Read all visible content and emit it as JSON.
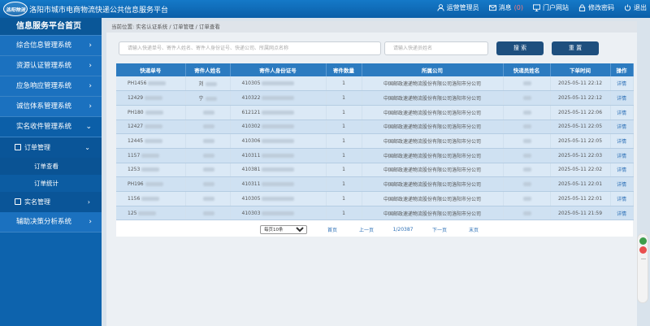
{
  "header": {
    "logo_text": "洛阳物流",
    "site_title": "洛阳市城市电商物流快递公共信息服务平台",
    "nav": [
      {
        "label": "运营管理员",
        "icon": "user-icon"
      },
      {
        "label": "消息",
        "count": "(0)",
        "icon": "mail-icon"
      },
      {
        "label": "门户网站",
        "icon": "monitor-icon"
      },
      {
        "label": "修改密码",
        "icon": "lock-icon"
      },
      {
        "label": "退出",
        "icon": "power-icon"
      }
    ]
  },
  "sidebar": {
    "title": "信息服务平台首页",
    "items": [
      {
        "label": "综合信息管理系统"
      },
      {
        "label": "资源认证管理系统"
      },
      {
        "label": "应急响应管理系统"
      },
      {
        "label": "诚信体系管理系统"
      },
      {
        "label": "实名收件管理系统"
      },
      {
        "label": "订单管理"
      },
      {
        "label": "订单查看"
      },
      {
        "label": "订单统计"
      },
      {
        "label": "实名管理"
      },
      {
        "label": "辅助决策分析系统"
      }
    ]
  },
  "breadcrumb": "当前位置: 实名认证系统 / 订单管理 / 订单查看",
  "search": {
    "placeholder_main": "请输入快递单号、寄件人姓名、寄件人身份证号、快递公司、所属网点名称",
    "placeholder_staff": "请输入快递员姓名",
    "search_label": "搜 索",
    "reset_label": "重 置"
  },
  "table": {
    "columns": [
      "快递单号",
      "寄件人姓名",
      "寄件人身份证号",
      "寄件数量",
      "所属公司",
      "快递员姓名",
      "下单时间",
      "操作"
    ],
    "rows": [
      {
        "no": "PH1456",
        "name": "刘",
        "id": "410305",
        "qty": "1",
        "company": "中国邮政速递物流股份有限公司洛阳市分公司",
        "courier": "",
        "time": "2025-05-11 22:12",
        "op": "详情"
      },
      {
        "no": "12429",
        "name": "宁",
        "id": "410322",
        "qty": "1",
        "company": "中国邮政速递物流股份有限公司洛阳市分公司",
        "courier": "",
        "time": "2025-05-11 22:12",
        "op": "详情"
      },
      {
        "no": "PH180",
        "name": "",
        "id": "612121",
        "qty": "1",
        "company": "中国邮政速递物流股份有限公司洛阳市分公司",
        "courier": "",
        "time": "2025-05-11 22:06",
        "op": "详情"
      },
      {
        "no": "12427",
        "name": "",
        "id": "410302",
        "qty": "1",
        "company": "中国邮政速递物流股份有限公司洛阳市分公司",
        "courier": "",
        "time": "2025-05-11 22:05",
        "op": "详情"
      },
      {
        "no": "12445",
        "name": "",
        "id": "410306",
        "qty": "1",
        "company": "中国邮政速递物流股份有限公司洛阳市分公司",
        "courier": "",
        "time": "2025-05-11 22:05",
        "op": "详情"
      },
      {
        "no": "1157",
        "name": "",
        "id": "410311",
        "qty": "1",
        "company": "中国邮政速递物流股份有限公司洛阳市分公司",
        "courier": "",
        "time": "2025-05-11 22:03",
        "op": "详情"
      },
      {
        "no": "1253",
        "name": "",
        "id": "410381",
        "qty": "1",
        "company": "中国邮政速递物流股份有限公司洛阳市分公司",
        "courier": "",
        "time": "2025-05-11 22:02",
        "op": "详情"
      },
      {
        "no": "PH196",
        "name": "",
        "id": "410311",
        "qty": "1",
        "company": "中国邮政速递物流股份有限公司洛阳市分公司",
        "courier": "",
        "time": "2025-05-11 22:01",
        "op": "详情"
      },
      {
        "no": "1156",
        "name": "",
        "id": "410305",
        "qty": "1",
        "company": "中国邮政速递物流股份有限公司洛阳市分公司",
        "courier": "",
        "time": "2025-05-11 22:01",
        "op": "详情"
      },
      {
        "no": "125",
        "name": "",
        "id": "410303",
        "qty": "1",
        "company": "中国邮政速递物流股份有限公司洛阳市分公司",
        "courier": "",
        "time": "2025-05-11 21:59",
        "op": "详情"
      }
    ]
  },
  "pager": {
    "page_size": "每页10条",
    "first": "首页",
    "prev": "上一页",
    "current": "1/20387",
    "next": "下一页",
    "last": "末页"
  },
  "colors": {
    "header_bg": "#0b5fa8",
    "sidebar_bg": "#0d63ad",
    "table_head": "#2c7bc0",
    "button": "#1e4f7e"
  }
}
